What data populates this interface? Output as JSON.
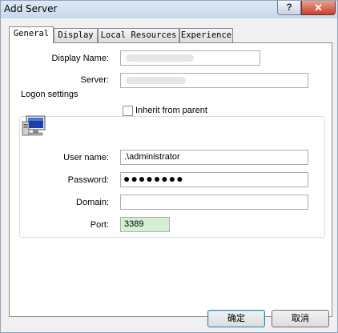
{
  "window": {
    "title": "Add Server",
    "help_label": "?",
    "close_label": "✕"
  },
  "tabs": [
    {
      "label": "General"
    },
    {
      "label": "Display"
    },
    {
      "label": "Local Resources"
    },
    {
      "label": "Experience"
    }
  ],
  "general": {
    "display_name_label": "Display Name:",
    "server_label": "Server:",
    "logon_group_title": "Logon settings",
    "inherit_label": "Inherit from parent",
    "username_label": "User name:",
    "username_value": ".\\administrator",
    "password_label": "Password:",
    "password_mask": "●●●●●●●●",
    "domain_label": "Domain:",
    "port_label": "Port:",
    "port_value": "3389"
  },
  "buttons": {
    "ok_label": "确定",
    "cancel_label": "取消"
  },
  "colors": {
    "port_field_bg": "#d4f0d4",
    "title_bar": "#c9d8ea",
    "close_button": "#c7412d"
  }
}
